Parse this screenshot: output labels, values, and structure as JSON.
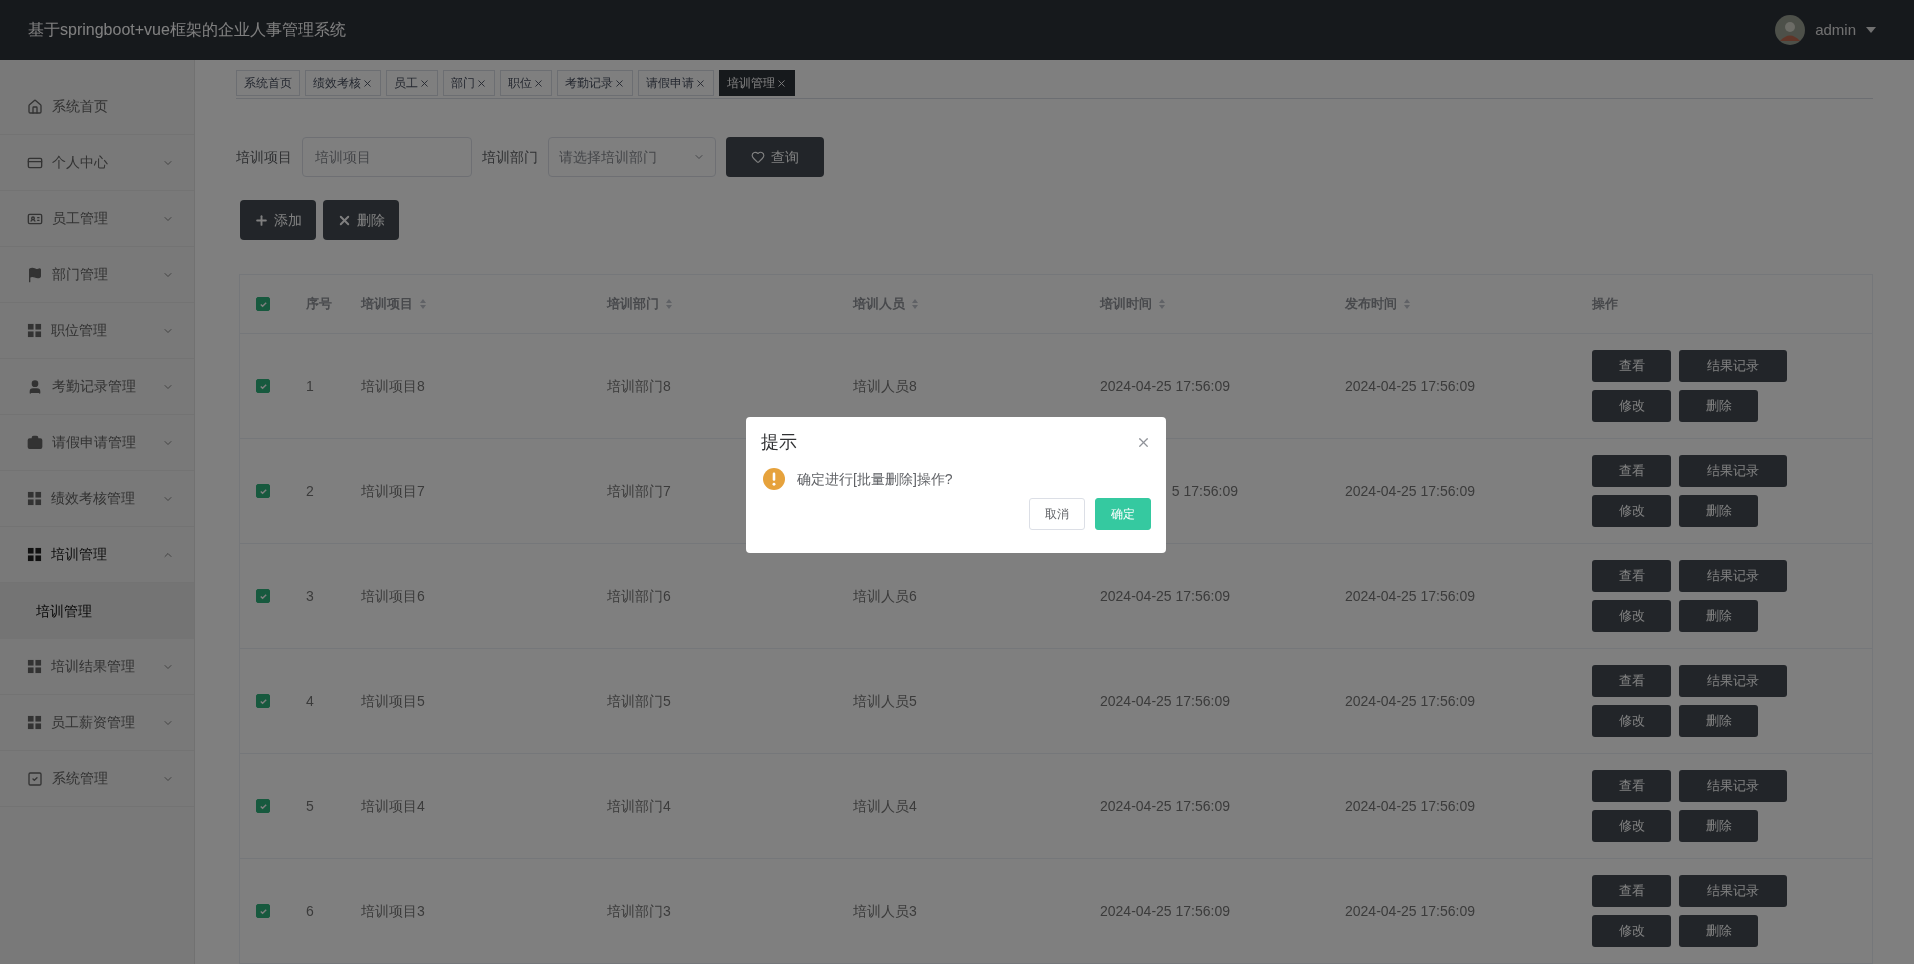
{
  "header": {
    "title": "基于springboot+vue框架的企业人事管理系统",
    "user": "admin"
  },
  "sidebar": {
    "items": [
      {
        "label": "系统首页",
        "kind": "link"
      },
      {
        "label": "个人中心",
        "kind": "submenu",
        "expanded": false
      },
      {
        "label": "员工管理",
        "kind": "submenu",
        "expanded": false
      },
      {
        "label": "部门管理",
        "kind": "submenu",
        "expanded": false
      },
      {
        "label": "职位管理",
        "kind": "submenu",
        "expanded": false
      },
      {
        "label": "考勤记录管理",
        "kind": "submenu",
        "expanded": false
      },
      {
        "label": "请假申请管理",
        "kind": "submenu",
        "expanded": false
      },
      {
        "label": "绩效考核管理",
        "kind": "submenu",
        "expanded": false
      },
      {
        "label": "培训管理",
        "kind": "submenu",
        "expanded": true,
        "children": [
          {
            "label": "培训管理",
            "selected": true
          }
        ]
      },
      {
        "label": "培训结果管理",
        "kind": "submenu",
        "expanded": false
      },
      {
        "label": "员工薪资管理",
        "kind": "submenu",
        "expanded": false
      },
      {
        "label": "系统管理",
        "kind": "submenu",
        "expanded": false
      }
    ]
  },
  "tabs": [
    {
      "label": "系统首页",
      "closable": false,
      "selected": false
    },
    {
      "label": "绩效考核",
      "closable": true,
      "selected": false
    },
    {
      "label": "员工",
      "closable": true,
      "selected": false
    },
    {
      "label": "部门",
      "closable": true,
      "selected": false
    },
    {
      "label": "职位",
      "closable": true,
      "selected": false
    },
    {
      "label": "考勤记录",
      "closable": true,
      "selected": false
    },
    {
      "label": "请假申请",
      "closable": true,
      "selected": false
    },
    {
      "label": "培训管理",
      "closable": true,
      "selected": true
    }
  ],
  "search": {
    "fields": [
      {
        "label": "培训项目",
        "kind": "input",
        "placeholder": "培训项目"
      },
      {
        "label": "培训部门",
        "kind": "select",
        "placeholder": "请选择培训部门"
      }
    ],
    "button": "查询"
  },
  "actions": [
    {
      "label": "添加",
      "kind": "add"
    },
    {
      "label": "删除",
      "kind": "delete"
    }
  ],
  "table": {
    "select_all": true,
    "columns": [
      {
        "label": "序号",
        "sortable": false
      },
      {
        "label": "培训项目",
        "sortable": true
      },
      {
        "label": "培训部门",
        "sortable": true
      },
      {
        "label": "培训人员",
        "sortable": true
      },
      {
        "label": "培训时间",
        "sortable": true
      },
      {
        "label": "发布时间",
        "sortable": true
      },
      {
        "label": "操作",
        "sortable": false
      }
    ],
    "rows": [
      {
        "checked": true,
        "cells": [
          "1",
          "培训项目8",
          "培训部门8",
          "培训人员8",
          "2024-04-25 17:56:09",
          "2024-04-25 17:56:09"
        ],
        "buttons": [
          "查看",
          "结果记录",
          "修改",
          "删除"
        ]
      },
      {
        "checked": true,
        "clipped": true,
        "cells": [
          "2",
          "培训项目7",
          "培训部门7",
          null,
          "5 17:56:09",
          "2024-04-25 17:56:09"
        ],
        "buttons": [
          "查看",
          "结果记录",
          "修改",
          "删除"
        ]
      },
      {
        "checked": true,
        "cells": [
          "3",
          "培训项目6",
          "培训部门6",
          "培训人员6",
          "2024-04-25 17:56:09",
          "2024-04-25 17:56:09"
        ],
        "buttons": [
          "查看",
          "结果记录",
          "修改",
          "删除"
        ]
      },
      {
        "checked": true,
        "cells": [
          "4",
          "培训项目5",
          "培训部门5",
          "培训人员5",
          "2024-04-25 17:56:09",
          "2024-04-25 17:56:09"
        ],
        "buttons": [
          "查看",
          "结果记录",
          "修改",
          "删除"
        ]
      },
      {
        "checked": true,
        "cells": [
          "5",
          "培训项目4",
          "培训部门4",
          "培训人员4",
          "2024-04-25 17:56:09",
          "2024-04-25 17:56:09"
        ],
        "buttons": [
          "查看",
          "结果记录",
          "修改",
          "删除"
        ]
      },
      {
        "checked": true,
        "cells": [
          "6",
          "培训项目3",
          "培训部门3",
          "培训人员3",
          "2024-04-25 17:56:09",
          "2024-04-25 17:56:09"
        ],
        "buttons": [
          "查看",
          "结果记录",
          "修改",
          "删除"
        ]
      }
    ]
  },
  "dialog": {
    "title": "提示",
    "message": "确定进行[批量删除]操作?",
    "buttons": [
      {
        "label": "取消",
        "kind": "secondary"
      },
      {
        "label": "确定",
        "kind": "primary"
      }
    ]
  }
}
